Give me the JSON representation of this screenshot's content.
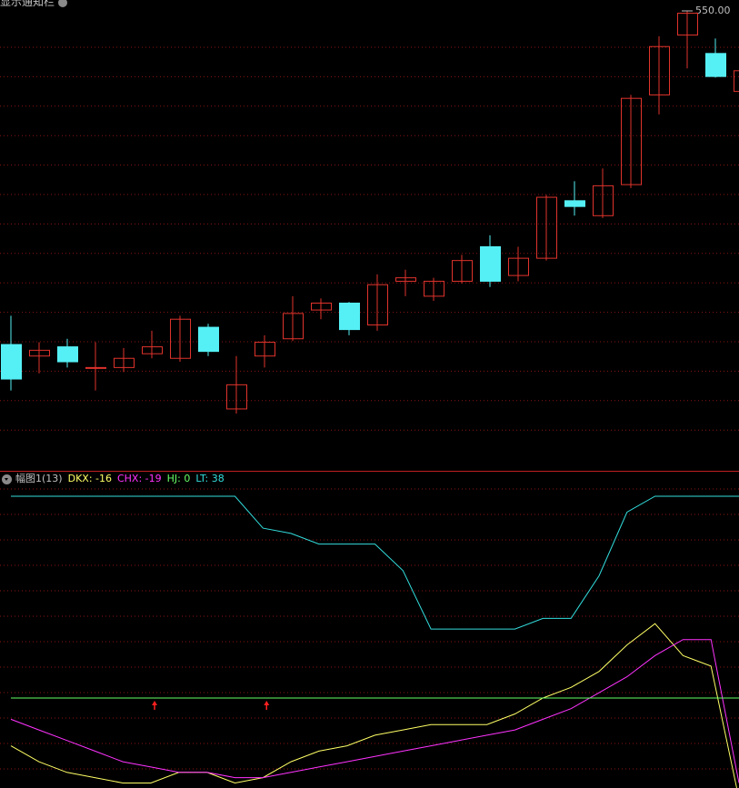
{
  "header": {
    "title": "显示通知栏"
  },
  "price_label": "550.00",
  "indicator": {
    "name": "幅图1(13)",
    "legend": [
      {
        "key": "dkx",
        "text": "DKX: -16",
        "color": "#ffff66"
      },
      {
        "key": "chx",
        "text": "CHX: -19",
        "color": "#ff33ff"
      },
      {
        "key": "hj",
        "text": "HJ: 0",
        "color": "#66ff66"
      },
      {
        "key": "lt",
        "text": "LT: 38",
        "color": "#33dddd"
      }
    ]
  },
  "colors": {
    "up": "#e0332c",
    "down": "#55f0f5",
    "grid": "#8b1414",
    "arrow": "#ff2020",
    "label": "#c0c0c0"
  },
  "chart_data": [
    {
      "type": "candlestick",
      "title": "",
      "ylim": [
        0,
        560
      ],
      "candles": [
        {
          "o": 260,
          "h": 285,
          "l": 220,
          "c": 230
        },
        {
          "o": 250,
          "h": 262,
          "l": 235,
          "c": 255
        },
        {
          "o": 258,
          "h": 265,
          "l": 240,
          "c": 245
        },
        {
          "o": 240,
          "h": 262,
          "l": 220,
          "c": 240
        },
        {
          "o": 240,
          "h": 257,
          "l": 236,
          "c": 248
        },
        {
          "o": 252,
          "h": 272,
          "l": 248,
          "c": 258
        },
        {
          "o": 248,
          "h": 285,
          "l": 245,
          "c": 282
        },
        {
          "o": 275,
          "h": 278,
          "l": 250,
          "c": 254
        },
        {
          "o": 204,
          "h": 250,
          "l": 200,
          "c": 225
        },
        {
          "o": 250,
          "h": 268,
          "l": 240,
          "c": 262
        },
        {
          "o": 265,
          "h": 302,
          "l": 263,
          "c": 287
        },
        {
          "o": 290,
          "h": 300,
          "l": 282,
          "c": 296
        },
        {
          "o": 296,
          "h": 297,
          "l": 268,
          "c": 273
        },
        {
          "o": 277,
          "h": 321,
          "l": 272,
          "c": 312
        },
        {
          "o": 315,
          "h": 325,
          "l": 302,
          "c": 318
        },
        {
          "o": 302,
          "h": 318,
          "l": 298,
          "c": 315
        },
        {
          "o": 315,
          "h": 338,
          "l": 313,
          "c": 333
        },
        {
          "o": 345,
          "h": 355,
          "l": 310,
          "c": 315
        },
        {
          "o": 320,
          "h": 345,
          "l": 315,
          "c": 335
        },
        {
          "o": 335,
          "h": 390,
          "l": 333,
          "c": 388
        },
        {
          "o": 385,
          "h": 402,
          "l": 372,
          "c": 380
        },
        {
          "o": 372,
          "h": 413,
          "l": 370,
          "c": 398
        },
        {
          "o": 399,
          "h": 477,
          "l": 396,
          "c": 474
        },
        {
          "o": 477,
          "h": 528,
          "l": 460,
          "c": 519
        },
        {
          "o": 529,
          "h": 550,
          "l": 500,
          "c": 548
        },
        {
          "o": 513,
          "h": 526,
          "l": 492,
          "c": 493
        },
        {
          "o": 480,
          "h": 500,
          "l": 478,
          "c": 498
        }
      ]
    },
    {
      "type": "line",
      "title": "幅图1(13)",
      "ylim": [
        -20,
        40
      ],
      "x_count": 27,
      "series": [
        {
          "name": "DKX",
          "color": "#ffff66",
          "values": [
            -9,
            -12,
            -14,
            -15,
            -16,
            -16,
            -14,
            -14,
            -16,
            -15,
            -12,
            -10,
            -9,
            -7,
            -6,
            -5,
            -5,
            -5,
            -3,
            0,
            2,
            5,
            10,
            14,
            8,
            6,
            -19
          ]
        },
        {
          "name": "CHX",
          "color": "#ff33ff",
          "values": [
            -4,
            -6,
            -8,
            -10,
            -12,
            -13,
            -14,
            -14,
            -15,
            -15,
            -14,
            -13,
            -12,
            -11,
            -10,
            -9,
            -8,
            -7,
            -6,
            -4,
            -2,
            1,
            4,
            8,
            11,
            11,
            -16
          ]
        },
        {
          "name": "HJ",
          "color": "#66ff66",
          "values": [
            0,
            0,
            0,
            0,
            0,
            0,
            0,
            0,
            0,
            0,
            0,
            0,
            0,
            0,
            0,
            0,
            0,
            0,
            0,
            0,
            0,
            0,
            0,
            0,
            0,
            0,
            0
          ]
        },
        {
          "name": "LT",
          "color": "#33dddd",
          "values": [
            38,
            38,
            38,
            38,
            38,
            38,
            38,
            38,
            38,
            32,
            31,
            29,
            29,
            29,
            24,
            13,
            13,
            13,
            13,
            15,
            15,
            23,
            35,
            38,
            38,
            38,
            38
          ]
        }
      ],
      "signals": [
        5,
        9
      ]
    }
  ]
}
